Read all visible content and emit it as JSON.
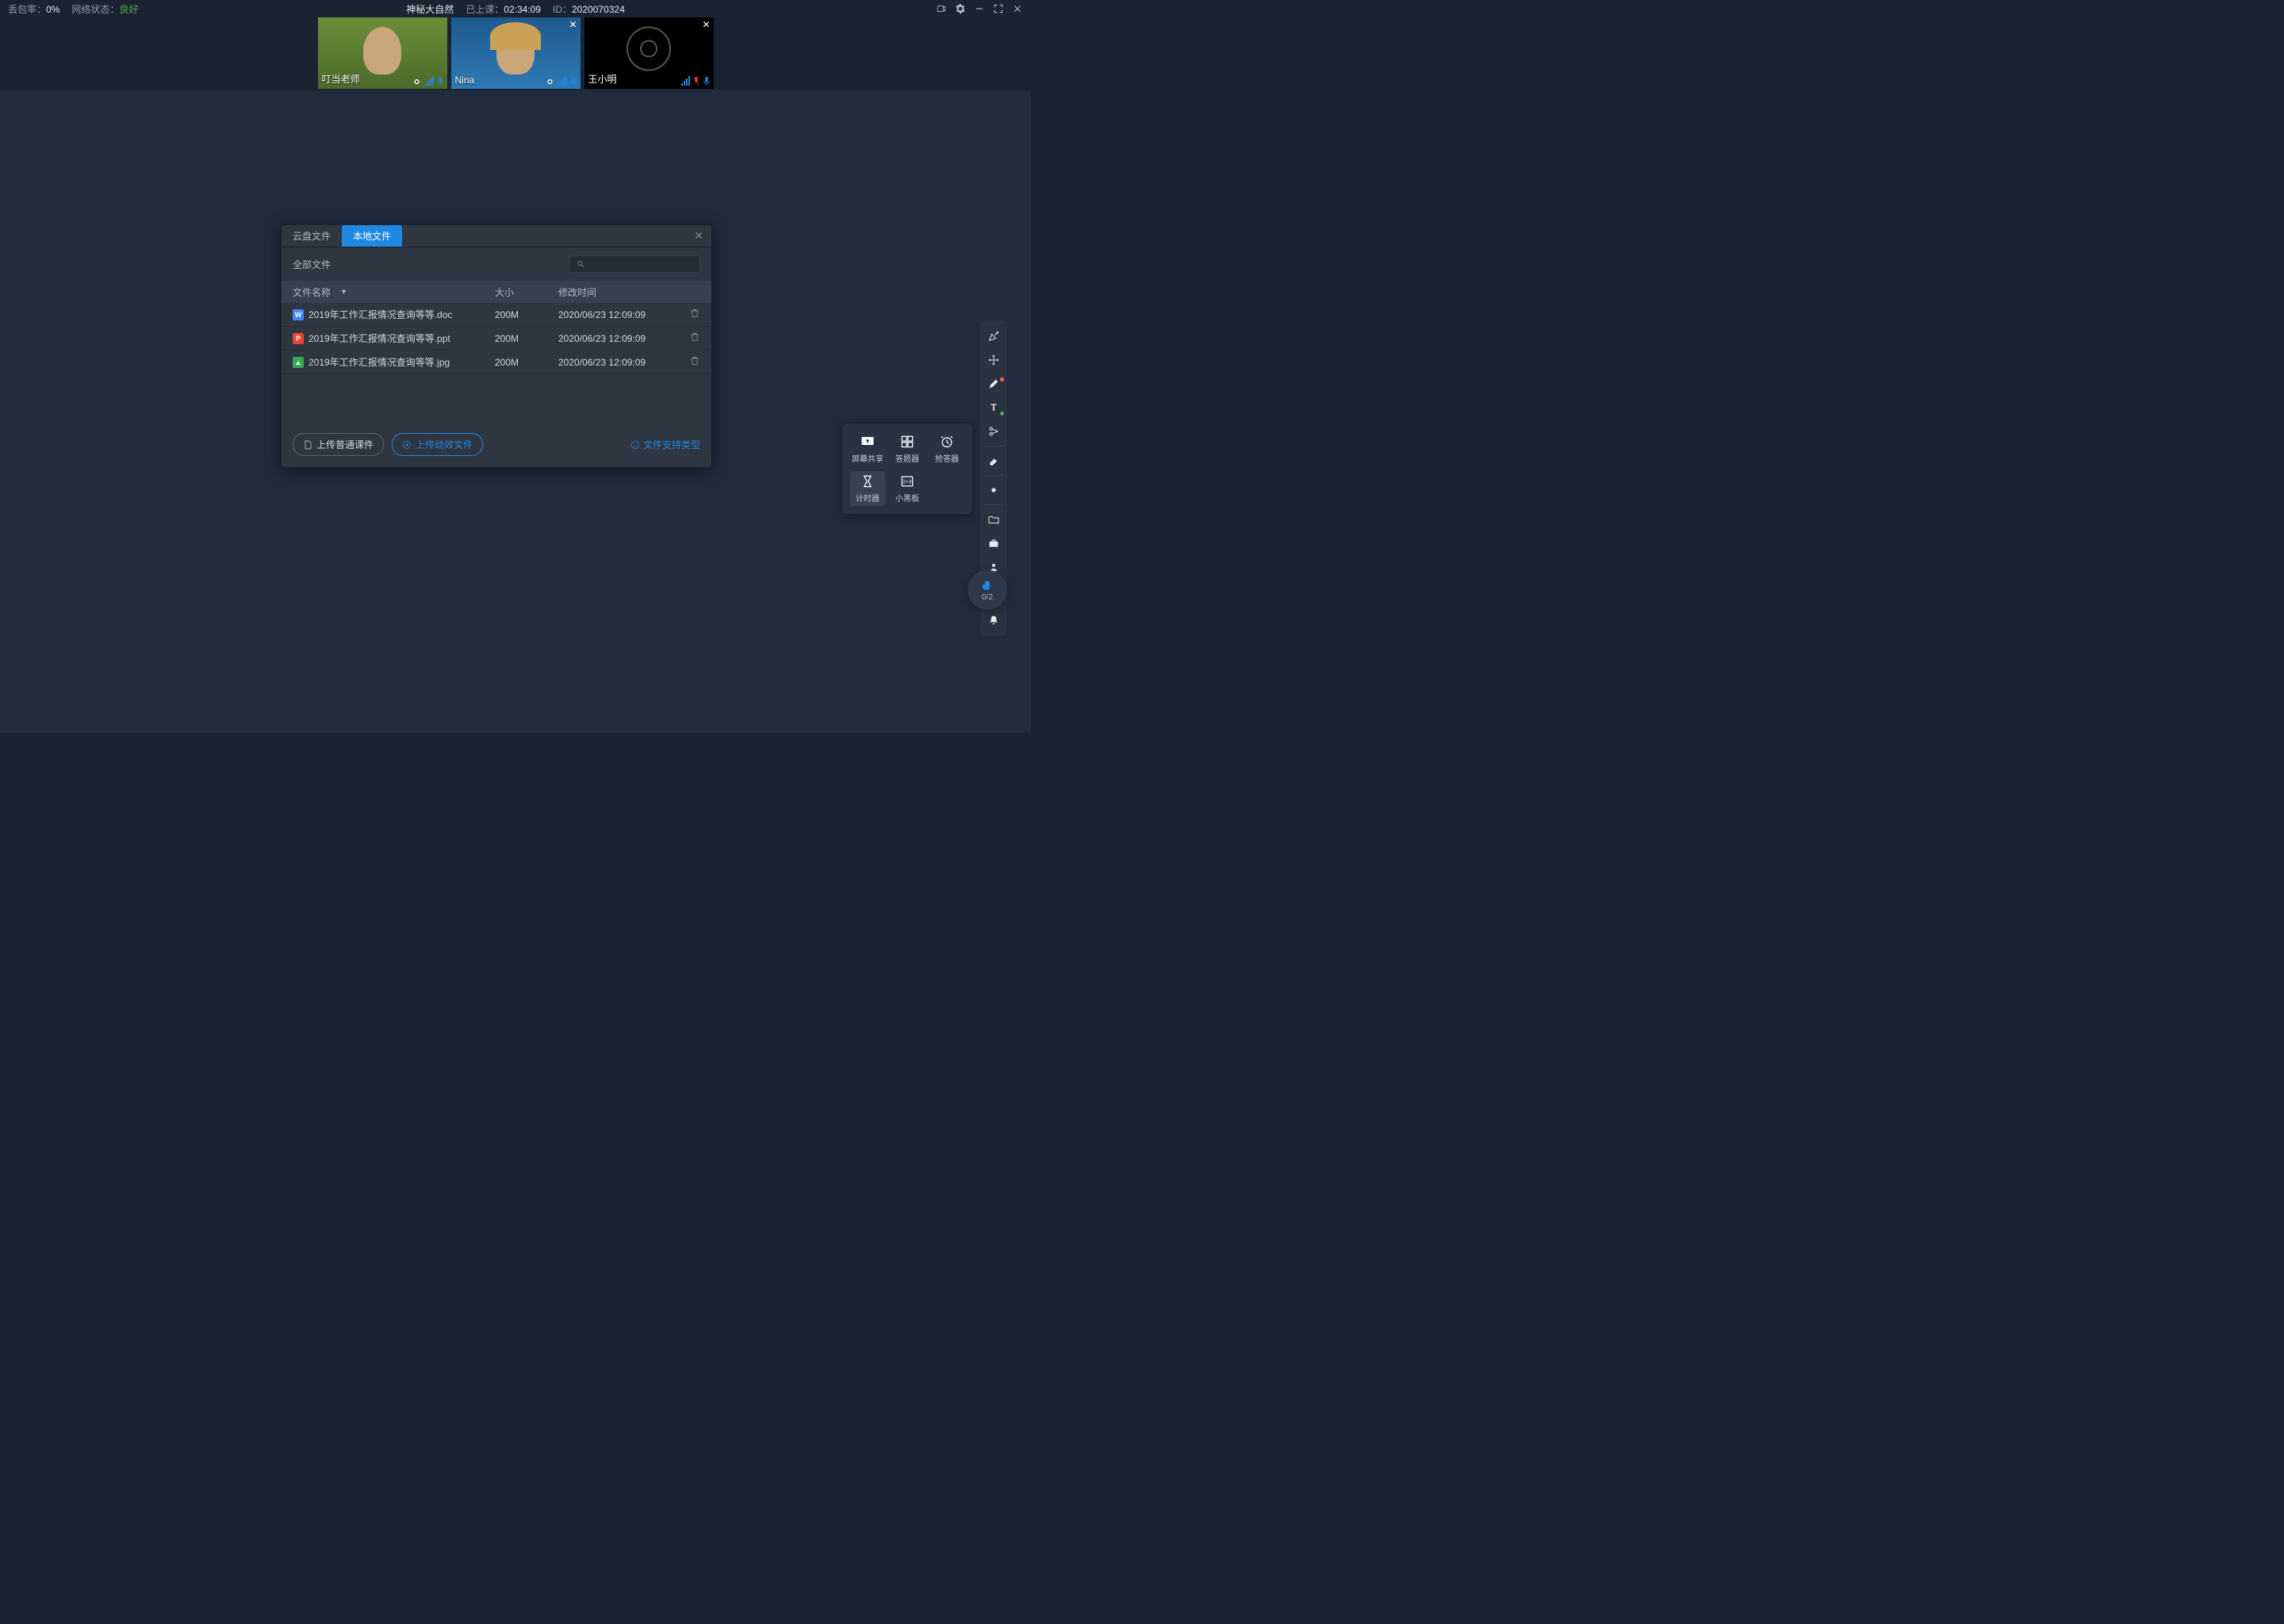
{
  "status": {
    "loss_label": "丢包率：",
    "loss_val": "0%",
    "net_label": "网络状态：",
    "net_val": "良好",
    "course_name": "神秘大自然",
    "elapsed_label": "已上课：",
    "elapsed_val": "02:34:09",
    "id_label": "ID：",
    "id_val": "2020070324"
  },
  "videos": [
    {
      "name": "叮当老师",
      "closable": false,
      "camera_off": false
    },
    {
      "name": "Nina",
      "closable": true,
      "camera_off": false
    },
    {
      "name": "王小明",
      "closable": true,
      "camera_off": true
    }
  ],
  "dialog": {
    "tab_cloud": "云盘文件",
    "tab_local": "本地文件",
    "all_files": "全部文件",
    "header_name": "文件名称",
    "header_size": "大小",
    "header_time": "修改时间",
    "files": [
      {
        "icon": "doc",
        "iconLetter": "W",
        "name": "2019年工作汇报情况查询等等.doc",
        "size": "200M",
        "time": "2020/06/23 12:09:09"
      },
      {
        "icon": "ppt",
        "iconLetter": "P",
        "name": "2019年工作汇报情况查询等等.ppt",
        "size": "200M",
        "time": "2020/06/23 12:09:09"
      },
      {
        "icon": "img",
        "iconLetter": "▲",
        "name": "2019年工作汇报情况查询等等.jpg",
        "size": "200M",
        "time": "2020/06/23 12:09:09"
      }
    ],
    "upload_normal": "上传普通课件",
    "upload_animated": "上传动效文件",
    "file_types": "文件支持类型"
  },
  "tools": {
    "screen_share": "屏幕共享",
    "answer": "答题器",
    "rush": "抢答器",
    "timer": "计时器",
    "blackboard": "小黑板"
  },
  "hand": {
    "count": "0/2"
  }
}
